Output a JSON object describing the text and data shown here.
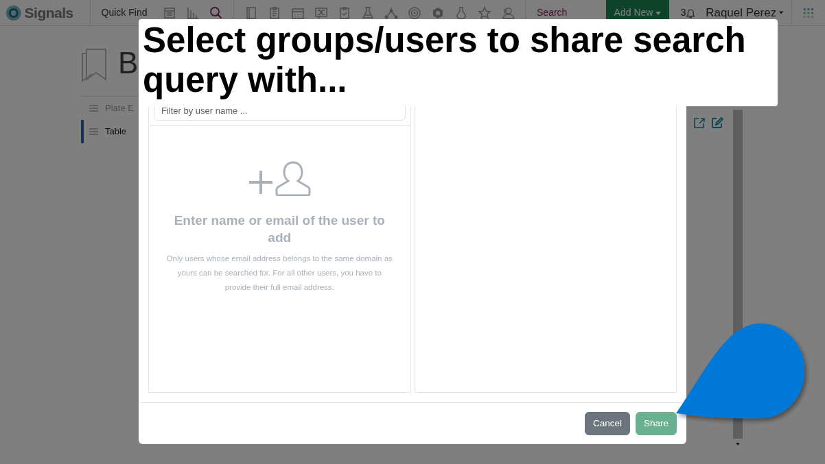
{
  "navbar": {
    "logo": "Signals",
    "quick_find": "Quick Find",
    "search": "Search",
    "add_new": "Add New",
    "notification_count": "3",
    "user": "Raquel Perez"
  },
  "page": {
    "title": "B",
    "list_items": [
      {
        "label": "Plate E",
        "selected": false
      },
      {
        "label": "Table",
        "selected": true
      }
    ]
  },
  "dialog": {
    "filter_placeholder": "Filter by user name ...",
    "empty_title": "Enter name or email of the user to add",
    "empty_text": "Only users whose email address belongs to the same domain as yours can be searched for. For all other users, you have to provide their full email address.",
    "buttons": [
      {
        "label": "Cancel",
        "kind": "secondary",
        "disabled": false
      },
      {
        "label": "Share",
        "kind": "success",
        "disabled": true
      }
    ]
  },
  "callout": {
    "text": "Select groups/users to share search query with..."
  }
}
